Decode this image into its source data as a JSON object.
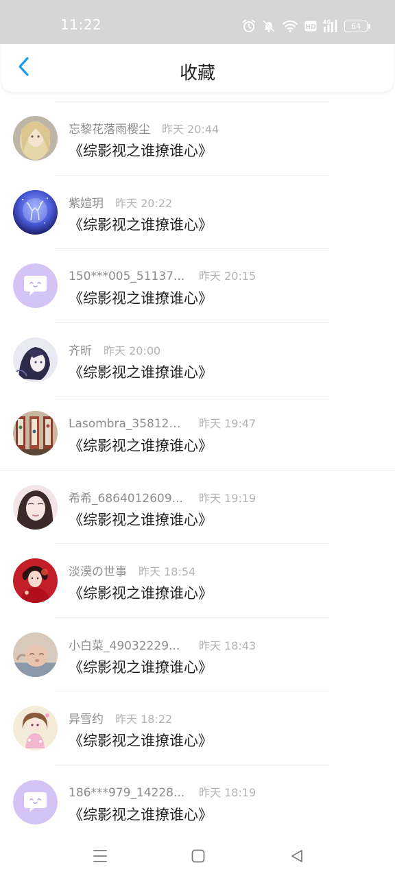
{
  "status_bar": {
    "time": "11:22",
    "icons": [
      "alarm-icon",
      "mute-icon",
      "wifi-icon",
      "hd-icon",
      "4g-signal-icon"
    ],
    "battery": "64"
  },
  "header": {
    "back_icon": "chevron-left-icon",
    "title": "收藏",
    "accent_color": "#1e9be8"
  },
  "favorites": [
    {
      "user": "忘黎花落雨樱尘",
      "time": "昨天 20:44",
      "book": "《综影视之谁撩谁心》",
      "avatar": "photo-doll"
    },
    {
      "user": "紫媗玥",
      "time": "昨天 20:22",
      "book": "《综影视之谁撩谁心》",
      "avatar": "photo-deer"
    },
    {
      "user": "150***005_51137...",
      "time": "昨天 20:15",
      "book": "《综影视之谁撩谁心》",
      "avatar": "default-chat-bubble"
    },
    {
      "user": "齐昕",
      "time": "昨天 20:00",
      "book": "《综影视之谁撩谁心》",
      "avatar": "photo-anime-girl"
    },
    {
      "user": "Lasombra_358127...",
      "time": "昨天 19:47",
      "book": "《综影视之谁撩谁心》",
      "avatar": "photo-screens"
    },
    {
      "user": "希希_6864012609...",
      "time": "昨天 19:19",
      "book": "《综影视之谁撩谁心》",
      "avatar": "photo-woman"
    },
    {
      "user": "淡漠の世事",
      "time": "昨天 18:54",
      "book": "《综影视之谁撩谁心》",
      "avatar": "photo-red-dress"
    },
    {
      "user": "小白菜_49032229...",
      "time": "昨天 18:43",
      "book": "《综影视之谁撩谁心》",
      "avatar": "photo-baby"
    },
    {
      "user": "异雪约",
      "time": "昨天 18:22",
      "book": "《综影视之谁撩谁心》",
      "avatar": "photo-cartoon-girl"
    },
    {
      "user": "186***979_14228...",
      "time": "昨天 18:19",
      "book": "《综影视之谁撩谁心》",
      "avatar": "default-chat-bubble"
    }
  ],
  "nav_bar": {
    "icons": [
      "menu-icon",
      "home-square-icon",
      "back-triangle-icon"
    ]
  }
}
